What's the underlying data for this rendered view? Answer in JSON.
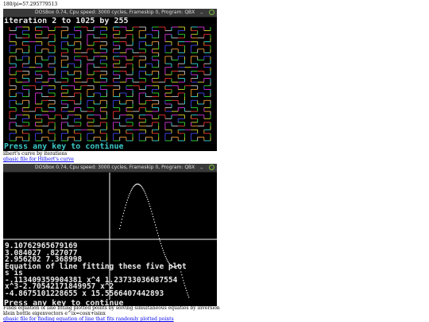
{
  "top_line": "180/pi=57.295779513",
  "window1": {
    "title": "DOSBox 0.74, Cpu speed:    3000 cycles, Frameskip  0, Program:     QBX",
    "minimize_glyph": "–",
    "screen_header": "iteration 2 to 1025 by 255",
    "screen_footer": "Press any key to continue",
    "colors": [
      "#e33",
      "#3d3",
      "#44e",
      "#dd3",
      "#d3d",
      "#3dd",
      "#e93",
      "#ccc"
    ]
  },
  "caption1": "ilbert's curve by iterations",
  "link1": "qbasic file for Hilbert's curve",
  "window2": {
    "title": "DOSBox 0.74, Cpu speed:    3000 cycles, Frameskip  0, Program:     QBX",
    "minimize_glyph": "–",
    "lines": [
      "9.10762965679169",
      "3.084027           .827077",
      "2.956202          7.368998",
      "Equation of line fitting these five plot",
      "s is",
      "-.113409359904381 x^4 1.23733036687554",
      "x^3-2.70542171849957 x^2",
      "-4.8675101228655 x 15.5566407442893"
    ],
    "screen_footer": "Press any key to continue"
  },
  "caption2": "Finds equation of line fitting plotted points by solving simultaneous equatios by inversion",
  "caption3": "klein bottle eigenvectors e^ix=cosx+isinx",
  "link2": "qbasic file for finding equation of line that fits randomly plotted points"
}
